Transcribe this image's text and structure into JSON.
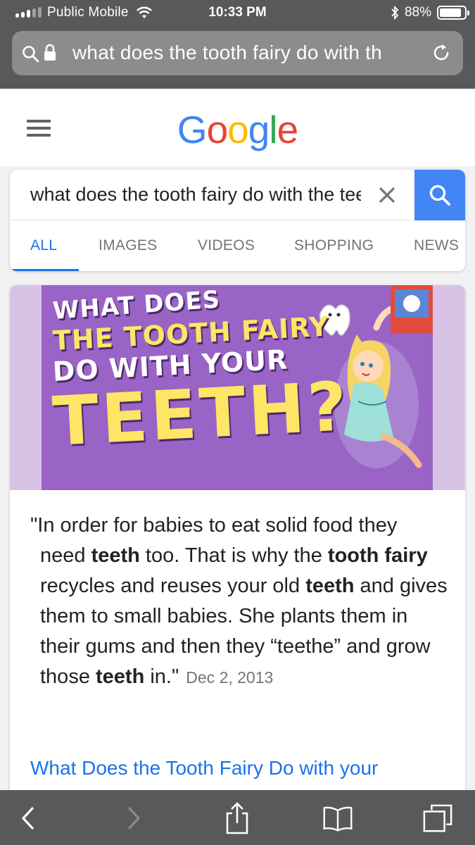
{
  "status_bar": {
    "carrier": "Public Mobile",
    "time": "10:33 PM",
    "battery_percent": "88%",
    "battery_level": 0.88,
    "signal_bars": 3,
    "signal_bars_total": 5
  },
  "safari": {
    "url_text": "what does the tooth fairy do with th",
    "icons": [
      "search-icon",
      "lock-icon",
      "reload-icon"
    ],
    "toolbar_icons": [
      "back-icon",
      "forward-icon",
      "share-icon",
      "bookmarks-icon",
      "tabs-icon"
    ]
  },
  "google": {
    "logo": [
      "G",
      "o",
      "o",
      "g",
      "l",
      "e"
    ],
    "query": "what does the tooth fairy do with the teeth",
    "tabs": [
      {
        "label": "ALL",
        "active": true
      },
      {
        "label": "IMAGES",
        "active": false
      },
      {
        "label": "VIDEOS",
        "active": false
      },
      {
        "label": "SHOPPING",
        "active": false
      },
      {
        "label": "NEWS",
        "active": false
      }
    ]
  },
  "result": {
    "thumbnail_text": [
      "WHAT DOES",
      "THE TOOTH FAIRY",
      "DO WITH YOUR",
      "TEETH?"
    ],
    "snippet_parts": [
      {
        "text": "\"In order for babies to eat solid food they",
        "bold": false
      },
      {
        "text": " need ",
        "bold": false
      },
      {
        "text": "teeth",
        "bold": true
      },
      {
        "text": " too. That is why the ",
        "bold": false
      },
      {
        "text": "tooth fairy",
        "bold": true
      },
      {
        "text": " recycles and reuses your old ",
        "bold": false
      },
      {
        "text": "teeth",
        "bold": true
      },
      {
        "text": " and gives them to small babies. She plants them in their gums and then they “teethe” and grow those ",
        "bold": false
      },
      {
        "text": "teeth",
        "bold": true
      },
      {
        "text": " in.\"",
        "bold": false
      }
    ],
    "date": "Dec 2, 2013",
    "link_title": "What Does the Tooth Fairy Do with your"
  },
  "colors": {
    "chrome": "#595959",
    "google_blue": "#4285f4",
    "google_red": "#ea4335",
    "google_yellow": "#fbbc05",
    "google_green": "#34a853",
    "link_blue": "#1a73e8"
  }
}
